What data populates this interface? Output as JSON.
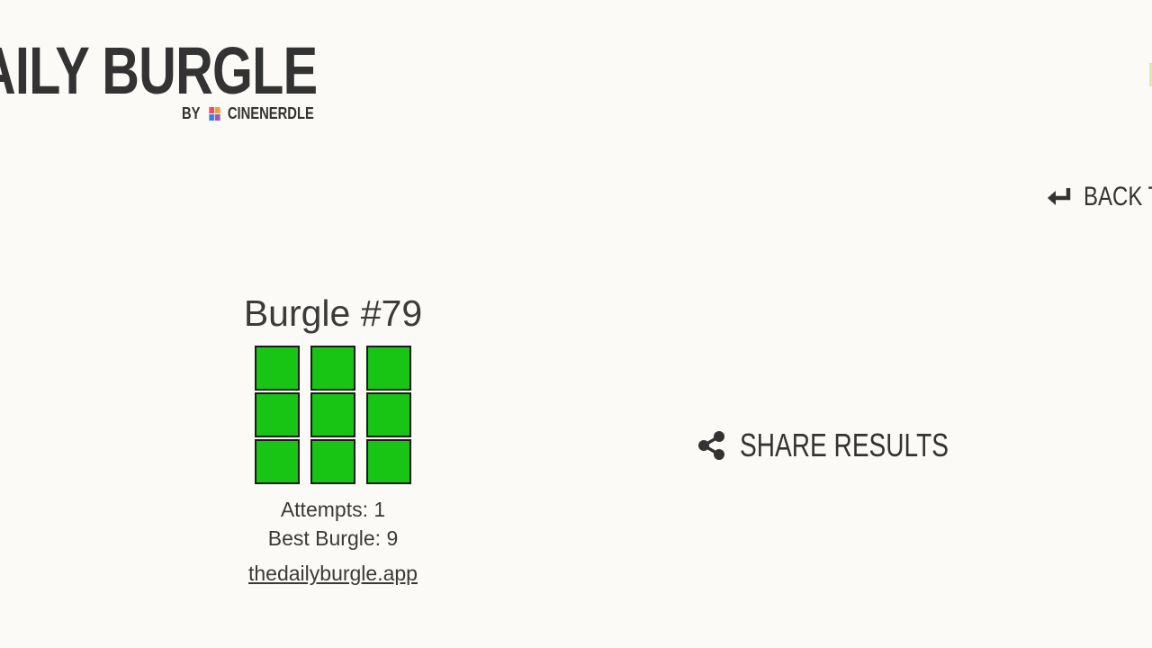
{
  "header": {
    "title": "AILY BURGLE",
    "byline_prefix": "BY",
    "byline_brand": "CINENERDLE",
    "brand_mark_colors": [
      "#e8515a",
      "#f0a23a",
      "#3d7fe0",
      "#9b59c7"
    ]
  },
  "nav": {
    "back_label": "BACK T",
    "back_icon": "return-arrow-icon"
  },
  "results": {
    "title": "Burgle #79",
    "grid": {
      "rows": 3,
      "cols": 3,
      "cells": [
        "correct",
        "correct",
        "correct",
        "correct",
        "correct",
        "correct",
        "correct",
        "correct",
        "correct"
      ],
      "correct_color": "#18c414"
    },
    "attempts": "Attempts: 1",
    "best": "Best Burgle: 9",
    "link": "thedailyburgle.app"
  },
  "share": {
    "label": "SHARE RESULTS",
    "icon": "share-icon"
  }
}
